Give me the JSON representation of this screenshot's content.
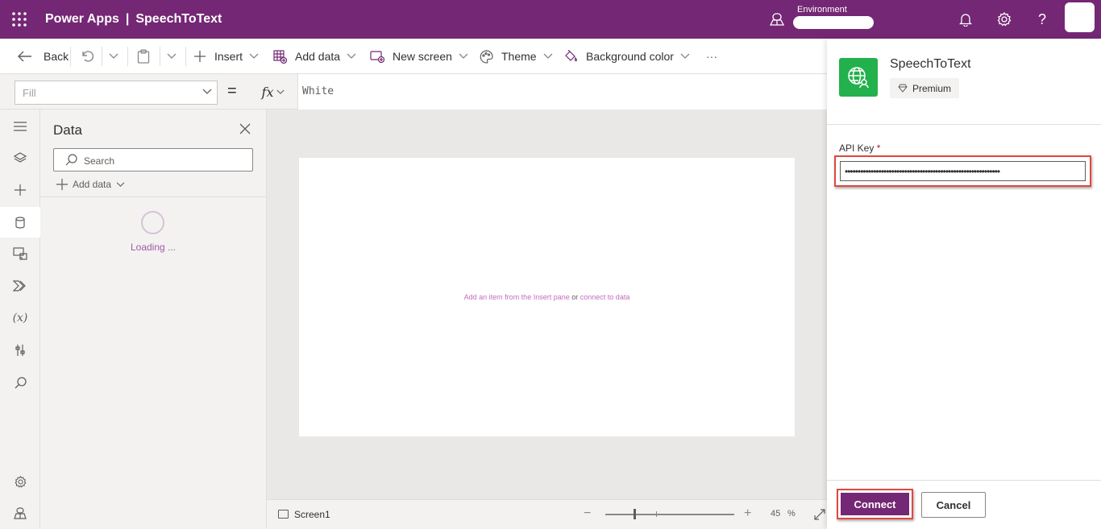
{
  "topbar": {
    "app_name": "Power Apps",
    "separator": "|",
    "app_title": "SpeechToText",
    "environment_label": "Environment"
  },
  "commandbar": {
    "back": "Back",
    "insert": "Insert",
    "add_data": "Add data",
    "new_screen": "New screen",
    "theme": "Theme",
    "background_color": "Background color",
    "more": "···"
  },
  "formulabar": {
    "property": "Fill",
    "equals": "=",
    "fx": "fx",
    "formula": "White"
  },
  "datapane": {
    "title": "Data",
    "search_placeholder": "Search",
    "add_data": "Add data",
    "loading": "Loading ..."
  },
  "canvas": {
    "hint_insert": "Add an item from the Insert pane",
    "hint_or": "or",
    "hint_connect": "connect to data"
  },
  "statusbar": {
    "screen_name": "Screen1",
    "zoom_minus": "−",
    "zoom_plus": "+",
    "zoom_value": "45",
    "zoom_unit": "%"
  },
  "connection": {
    "name": "SpeechToText",
    "badge": "Premium",
    "api_key_label": "API Key",
    "required_mark": "*",
    "api_key_value": "••••••••••••••••••••••••••••••••••••••••••••••••••••••••••••",
    "connect_label": "Connect",
    "cancel_label": "Cancel"
  },
  "colors": {
    "brand": "#742774",
    "connector_icon_bg": "#22b14c",
    "highlight_border": "#e0483d"
  }
}
